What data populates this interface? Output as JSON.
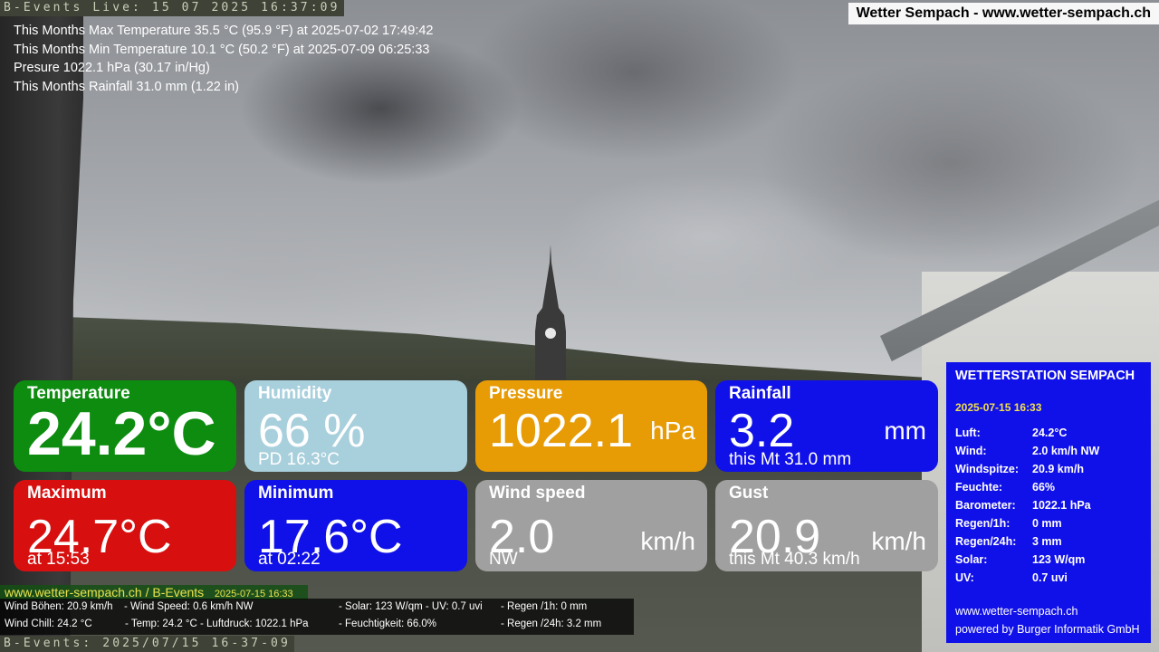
{
  "stamps": {
    "top": "B-Events Live: 15 07 2025 16:37:09",
    "bottom": "B-Events: 2025/07/15 16-37-09"
  },
  "brand": "Wetter Sempach - www.wetter-sempach.ch",
  "monthly": {
    "max": "This Months Max Temperature 35.5 °C (95.9 °F) at 2025-07-02 17:49:42",
    "min": "This Months Min Temperature 10.1 °C (50.2 °F) at 2025-07-09 06:25:33",
    "pressure": "Presure 1022.1 hPa (30.17 in/Hg)",
    "rain": "This Months Rainfall 31.0 mm (1.22 in)"
  },
  "cards": {
    "temperature": {
      "title": "Temperature",
      "value": "24.2°C",
      "color": "#0d8c10"
    },
    "humidity": {
      "title": "Humidity",
      "value": "66 %",
      "sub": "PD 16.3°C",
      "color": "#a8cfdc"
    },
    "pressure": {
      "title": "Pressure",
      "value": "1022.1",
      "unit": "hPa",
      "color": "#e79b05"
    },
    "rainfall": {
      "title": "Rainfall",
      "value": "3.2",
      "unit": "mm",
      "sub": "this Mt 31.0 mm",
      "color": "#1010e8"
    },
    "maximum": {
      "title": "Maximum",
      "value": "24.7°C",
      "sub": "at 15:53",
      "color": "#d80f0f"
    },
    "minimum": {
      "title": "Minimum",
      "value": "17.6°C",
      "sub": "at 02:22",
      "color": "#1010e8"
    },
    "windspeed": {
      "title": "Wind speed",
      "value": "2.0",
      "unit": "km/h",
      "sub": "NW",
      "color": "#a0a0a0"
    },
    "gust": {
      "title": "Gust",
      "value": "20.9",
      "unit": "km/h",
      "sub": "this Mt 40.3 km/h",
      "color": "#a0a0a0"
    }
  },
  "station": {
    "title": "WETTERSTATION SEMPACH",
    "date": "2025-07-15 16:33",
    "rows": [
      {
        "k": "Luft:",
        "v": "24.2°C"
      },
      {
        "k": "Wind:",
        "v": "2.0 km/h  NW"
      },
      {
        "k": "Windspitze:",
        "v": "20.9 km/h"
      },
      {
        "k": "Feuchte:",
        "v": "66%"
      },
      {
        "k": "Barometer:",
        "v": "1022.1 hPa"
      },
      {
        "k": "Regen/1h:",
        "v": "0 mm"
      },
      {
        "k": "Regen/24h:",
        "v": "3 mm"
      },
      {
        "k": "Solar:",
        "v": "123 W/qm"
      },
      {
        "k": "UV:",
        "v": "0.7 uvi"
      }
    ],
    "footer_site": "www.wetter-sempach.ch",
    "footer_credit": "powered by Burger Informatik GmbH"
  },
  "strip": {
    "site": "www.wetter-sempach.ch / B-Events",
    "stamp": "2025-07-15 16:33"
  },
  "ticker": {
    "wind_gusts": "Wind Böhen: 20.9 km/h",
    "wind_speed": "- Wind Speed: 0.6 km/h NW",
    "solar_uv": "- Solar: 123 W/qm   - UV: 0.7 uvi",
    "rain_1h": "- Regen /1h:   0 mm",
    "wind_chill": "Wind Chill: 24.2 °C",
    "temp_pressure": "- Temp: 24.2 °C  - Luftdruck: 1022.1 hPa",
    "humidity": "- Feuchtigkeit: 66.0%",
    "rain_24h": "- Regen /24h: 3.2 mm"
  }
}
